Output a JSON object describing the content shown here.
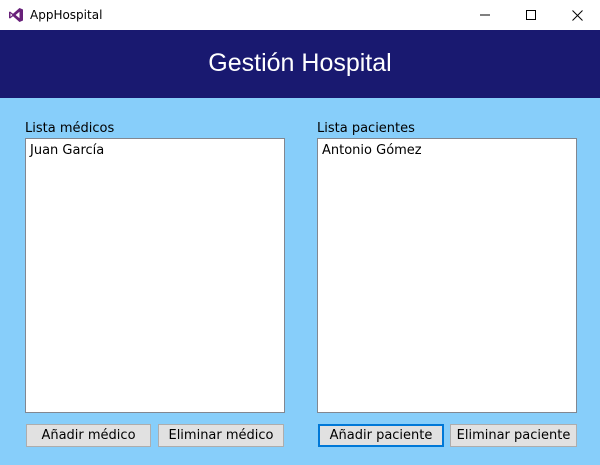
{
  "window": {
    "title": "AppHospital"
  },
  "header": {
    "title": "Gestión Hospital"
  },
  "doctors": {
    "label": "Lista médicos",
    "items": [
      "Juan García"
    ],
    "add_label": "Añadir médico",
    "remove_label": "Eliminar médico"
  },
  "patients": {
    "label": "Lista pacientes",
    "items": [
      "Antonio Gómez"
    ],
    "add_label": "Añadir paciente",
    "remove_label": "Eliminar paciente"
  },
  "colors": {
    "header_bg": "#191970",
    "content_bg": "#87cefa",
    "focus_border": "#0078d7"
  }
}
